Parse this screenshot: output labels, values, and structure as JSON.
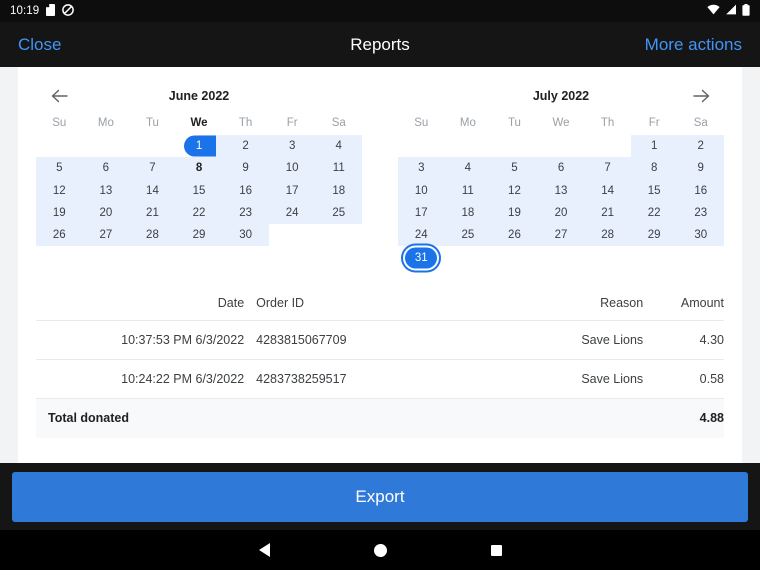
{
  "status_bar": {
    "time": "10:19",
    "left_icons": [
      "save-disk-icon",
      "do-not-disturb-icon"
    ],
    "right_icons": [
      "wifi-icon",
      "cell-signal-icon",
      "battery-icon"
    ]
  },
  "app_bar": {
    "close_label": "Close",
    "title": "Reports",
    "more_actions_label": "More actions"
  },
  "calendar": {
    "prev_icon": "arrow-left-icon",
    "next_icon": "arrow-right-icon",
    "weekdays": [
      "Su",
      "Mo",
      "Tu",
      "We",
      "Th",
      "Fr",
      "Sa"
    ],
    "accent_color": "#1a73e8",
    "range_color": "#e8f0fe",
    "months": [
      {
        "label": "June 2022",
        "today_weekday_index": 3,
        "weeks": [
          [
            null,
            null,
            null,
            "1",
            "2",
            "3",
            "4"
          ],
          [
            "5",
            "6",
            "7",
            "8",
            "9",
            "10",
            "11"
          ],
          [
            "12",
            "13",
            "14",
            "15",
            "16",
            "17",
            "18"
          ],
          [
            "19",
            "20",
            "21",
            "22",
            "23",
            "24",
            "25"
          ],
          [
            "26",
            "27",
            "28",
            "29",
            "30",
            null,
            null
          ]
        ],
        "selected_start": "1",
        "today": "8"
      },
      {
        "label": "July 2022",
        "today_weekday_index": -1,
        "weeks": [
          [
            null,
            null,
            null,
            null,
            null,
            "1",
            "2"
          ],
          [
            "3",
            "4",
            "5",
            "6",
            "7",
            "8",
            "9"
          ],
          [
            "10",
            "11",
            "12",
            "13",
            "14",
            "15",
            "16"
          ],
          [
            "17",
            "18",
            "19",
            "20",
            "21",
            "22",
            "23"
          ],
          [
            "24",
            "25",
            "26",
            "27",
            "28",
            "29",
            "30"
          ],
          [
            "31",
            null,
            null,
            null,
            null,
            null,
            null
          ]
        ],
        "selected_end": "31"
      }
    ]
  },
  "table": {
    "headers": {
      "date": "Date",
      "order_id": "Order ID",
      "reason": "Reason",
      "amount": "Amount"
    },
    "rows": [
      {
        "date": "10:37:53 PM 6/3/2022",
        "order_id": "4283815067709",
        "reason": "Save Lions",
        "amount": "4.30"
      },
      {
        "date": "10:24:22 PM 6/3/2022",
        "order_id": "4283738259517",
        "reason": "Save Lions",
        "amount": "0.58"
      }
    ],
    "total": {
      "label": "Total donated",
      "amount": "4.88"
    }
  },
  "export": {
    "label": "Export",
    "color": "#2f7ad8"
  },
  "nav_bar": {
    "back_icon": "triangle-back-icon",
    "home_icon": "circle-home-icon",
    "recents_icon": "square-recents-icon"
  }
}
